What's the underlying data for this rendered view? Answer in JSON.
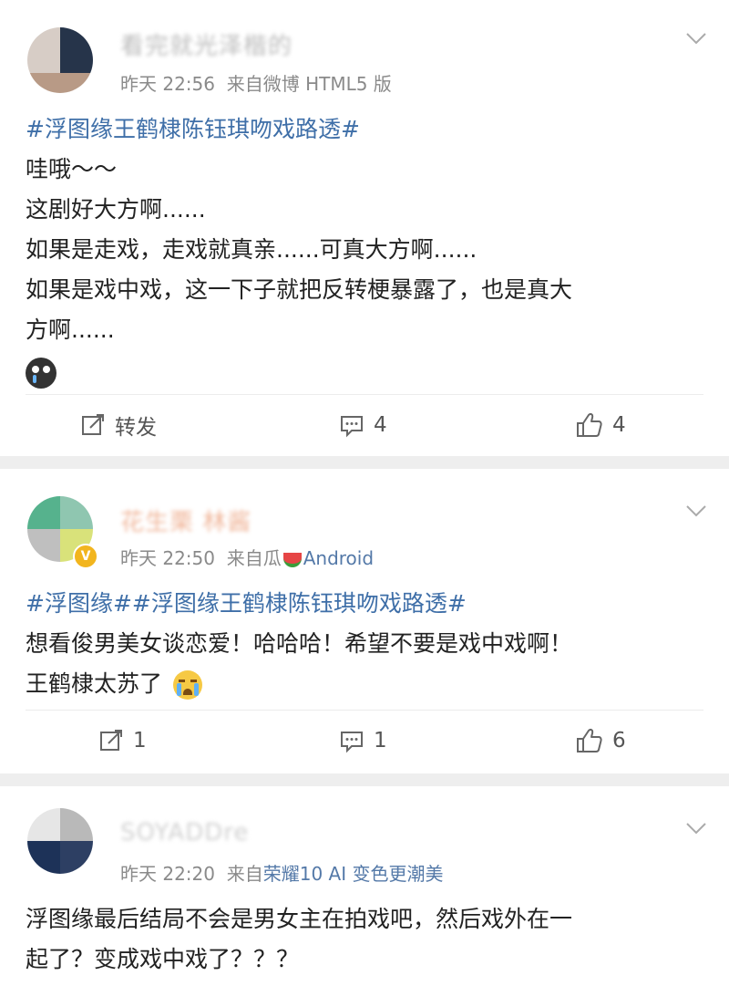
{
  "posts": [
    {
      "name": "看完就光泽楷的",
      "time": "昨天 22:56",
      "from_prefix": "来自",
      "source": "微博 HTML5 版",
      "tag_line": "#浮图缘王鹤棣陈钰琪吻戏路透#",
      "lines": [
        "哇哦～～",
        "这剧好大方啊......",
        "如果是走戏，走戏就真亲......可真大方啊......",
        "如果是戏中戏，这一下子就把反转梗暴露了，也是真大",
        "方啊......"
      ],
      "repost": "转发",
      "comments": "4",
      "likes": "4"
    },
    {
      "name": "花生栗 林酱",
      "time": "昨天 22:50",
      "from_prefix": "来自",
      "source_a": "瓜",
      "source_b": "Android",
      "tag_line": "#浮图缘##浮图缘王鹤棣陈钰琪吻戏路透#",
      "lines": [
        "想看俊男美女谈恋爱！哈哈哈！希望不要是戏中戏啊！",
        "王鹤棣太苏了"
      ],
      "repost": "1",
      "comments": "1",
      "likes": "6"
    },
    {
      "name": "SOYADDre",
      "time": "昨天 22:20",
      "from_prefix": "来自",
      "source": "荣耀10 AI 变色更潮美",
      "lines": [
        "浮图缘最后结局不会是男女主在拍戏吧，然后戏外在一",
        "起了？变成戏中戏了？？？"
      ]
    }
  ],
  "colors": {
    "link": "#3f6fa8",
    "meta": "#8a8a8a",
    "separator": "#eeeeee"
  }
}
